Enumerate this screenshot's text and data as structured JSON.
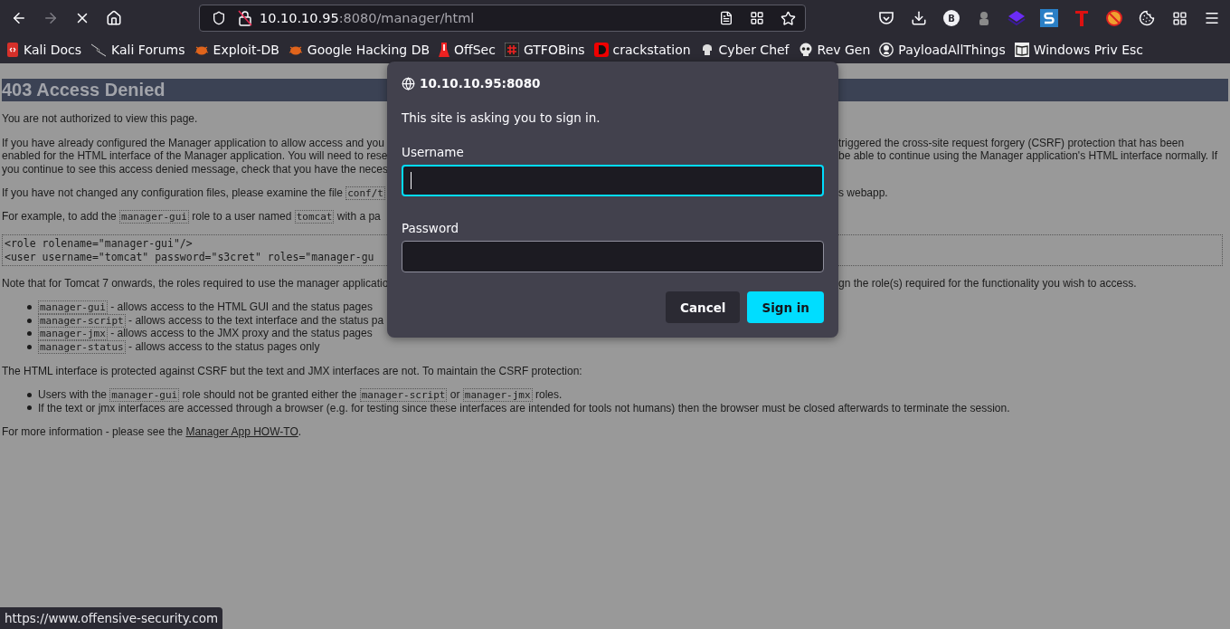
{
  "browser": {
    "nav": {
      "forward_disabled": true,
      "loading": true
    },
    "url": {
      "host": "10.10.10.95",
      "rest": ":8080/manager/html"
    },
    "toolbar_badge": "B",
    "bookmarks": [
      {
        "label": "Kali Docs"
      },
      {
        "label": "Kali Forums"
      },
      {
        "label": "Exploit-DB"
      },
      {
        "label": "Google Hacking DB"
      },
      {
        "label": "OffSec"
      },
      {
        "label": "GTFOBins"
      },
      {
        "label": "crackstation"
      },
      {
        "label": "Cyber Chef"
      },
      {
        "label": "Rev Gen"
      },
      {
        "label": "PayloadAllThings"
      },
      {
        "label": "Windows Priv Esc"
      }
    ]
  },
  "page": {
    "heading": "403 Access Denied",
    "blocks": [
      {
        "kind": "p",
        "lines": [
          {
            "left": [
              {
                "kind": "text",
                "text": "You are not authorized to view this page."
              }
            ]
          }
        ]
      },
      {
        "kind": "p",
        "lines": [
          {
            "left": [
              {
                "kind": "text",
                "text": "If you have already configured the Manager application to allow access and you"
              }
            ],
            "right": [
              {
                "kind": "text",
                "text": "triggered the cross-site request forgery (CSRF) protection that has been"
              }
            ]
          },
          {
            "left": [
              {
                "kind": "text",
                "text": "enabled for the HTML interface of the Manager application. You will need to rese"
              }
            ],
            "right": [
              {
                "kind": "text",
                "text": "be able to continue using the Manager application's HTML interface normally. If"
              }
            ]
          },
          {
            "left": [
              {
                "kind": "text",
                "text": "you continue to see this access denied message, check that you have the neces"
              }
            ]
          }
        ]
      },
      {
        "kind": "p",
        "lines": [
          {
            "left": [
              {
                "kind": "text",
                "text": "If you have not changed any configuration files, please examine the file "
              },
              {
                "kind": "code",
                "text": "conf/t"
              }
            ],
            "right": [
              {
                "kind": "text",
                "text": "s webapp."
              }
            ]
          }
        ]
      },
      {
        "kind": "p",
        "lines": [
          {
            "left": [
              {
                "kind": "text",
                "text": "For example, to add the "
              },
              {
                "kind": "code",
                "text": "manager-gui"
              },
              {
                "kind": "text",
                "text": " role to a user named "
              },
              {
                "kind": "code",
                "text": "tomcat"
              },
              {
                "kind": "text",
                "text": " with a pa"
              }
            ]
          }
        ]
      },
      {
        "kind": "pre",
        "lines": [
          {
            "left": [
              {
                "kind": "text",
                "text": "<role rolename=\"manager-gui\"/>"
              }
            ]
          },
          {
            "left": [
              {
                "kind": "text",
                "text": "<user username=\"tomcat\" password=\"s3cret\" roles=\"manager-gu"
              }
            ]
          }
        ]
      },
      {
        "kind": "p",
        "lines": [
          {
            "left": [
              {
                "kind": "text",
                "text": "Note that for Tomcat 7 onwards, the roles required to use the manager applicatio"
              }
            ],
            "right": [
              {
                "kind": "text",
                "text": "gn the role(s) required for the functionality you wish to access."
              }
            ]
          }
        ]
      },
      {
        "kind": "ul",
        "lines": [
          {
            "left": [
              {
                "kind": "code",
                "text": "manager-gui"
              },
              {
                "kind": "text",
                "text": " - allows access to the HTML GUI and the status pages"
              }
            ]
          },
          {
            "left": [
              {
                "kind": "code",
                "text": "manager-script"
              },
              {
                "kind": "text",
                "text": " - allows access to the text interface and the status pa"
              }
            ]
          },
          {
            "left": [
              {
                "kind": "code",
                "text": "manager-jmx"
              },
              {
                "kind": "text",
                "text": " - allows access to the JMX proxy and the status pages"
              }
            ]
          },
          {
            "left": [
              {
                "kind": "code",
                "text": "manager-status"
              },
              {
                "kind": "text",
                "text": " - allows access to the status pages only"
              }
            ]
          }
        ]
      },
      {
        "kind": "p",
        "lines": [
          {
            "left": [
              {
                "kind": "text",
                "text": "The HTML interface is protected against CSRF but the text and JMX interfaces are not. To maintain the CSRF protection:"
              }
            ]
          }
        ]
      },
      {
        "kind": "ul",
        "lines": [
          {
            "left": [
              {
                "kind": "text",
                "text": "Users with the "
              },
              {
                "kind": "code",
                "text": "manager-gui"
              },
              {
                "kind": "text",
                "text": " role should not be granted either the "
              },
              {
                "kind": "code",
                "text": "manager-script"
              },
              {
                "kind": "text",
                "text": " or "
              },
              {
                "kind": "code",
                "text": "manager-jmx"
              },
              {
                "kind": "text",
                "text": " roles."
              }
            ]
          },
          {
            "left": [
              {
                "kind": "text",
                "text": "If the text or jmx interfaces are accessed through a browser (e.g. for testing since these interfaces are intended for tools not humans) then the browser must be closed afterwards to terminate the session."
              }
            ]
          }
        ]
      },
      {
        "kind": "p",
        "lines": [
          {
            "left": [
              {
                "kind": "text",
                "text": "For more information - please see the "
              },
              {
                "kind": "link",
                "text": "Manager App HOW-TO"
              },
              {
                "kind": "text",
                "text": "."
              }
            ]
          }
        ]
      }
    ]
  },
  "dialog": {
    "site": "10.10.10.95:8080",
    "message": "This site is asking you to sign in.",
    "fields": [
      {
        "label": "Username",
        "focused": true
      },
      {
        "label": "Password",
        "focused": false
      }
    ],
    "buttons": [
      {
        "label": "Cancel",
        "kind": "secondary"
      },
      {
        "label": "Sign in",
        "kind": "primary"
      }
    ]
  },
  "status_bar": "https://www.offensive-security.com"
}
